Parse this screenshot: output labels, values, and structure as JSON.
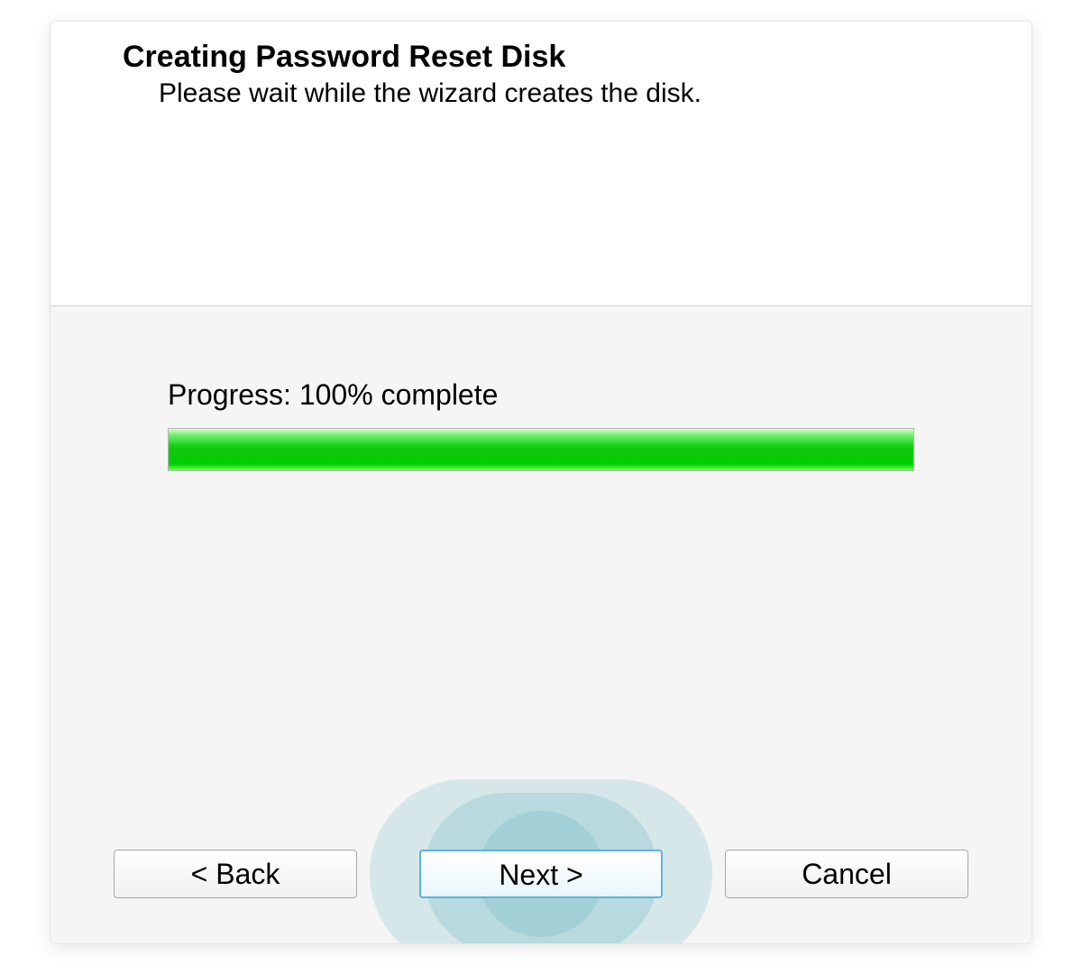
{
  "header": {
    "title": "Creating Password Reset Disk",
    "subtitle": "Please wait while the wizard creates the disk."
  },
  "progress": {
    "label": "Progress: 100% complete",
    "percent": 100
  },
  "buttons": {
    "back": "< Back",
    "next": "Next >",
    "cancel": "Cancel"
  }
}
